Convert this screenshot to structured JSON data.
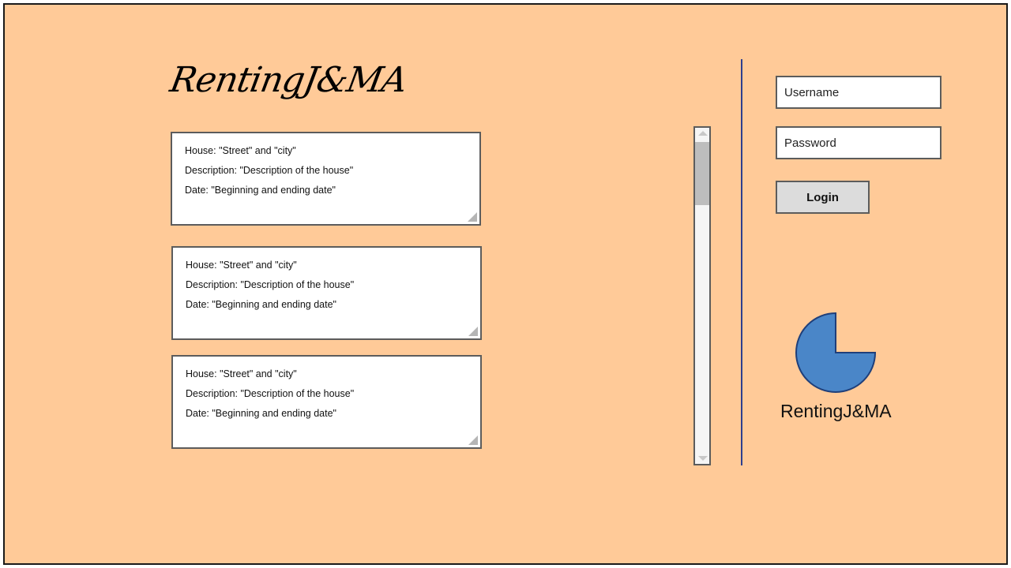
{
  "app": {
    "logo_text": "RentingJ&MA"
  },
  "listings": [
    {
      "house": "House: \"Street\" and \"city\"",
      "description": "Description: \"Description of the house\"",
      "date": "Date: \"Beginning and ending date\""
    },
    {
      "house": "House: \"Street\" and \"city\"",
      "description": "Description: \"Description of the house\"",
      "date": "Date: \"Beginning and ending date\""
    },
    {
      "house": "House: \"Street\" and \"city\"",
      "description": "Description: \"Description of the house\"",
      "date": "Date: \"Beginning and ending date\""
    }
  ],
  "login": {
    "username_placeholder": "Username",
    "password_placeholder": "Password",
    "button_label": "Login"
  },
  "brand": {
    "name": "RentingJ&MA",
    "logo_color": "#4a86c8",
    "logo_stroke": "#1f3f7a"
  },
  "colors": {
    "background": "#ffca98",
    "divider": "#2e3f8f"
  }
}
